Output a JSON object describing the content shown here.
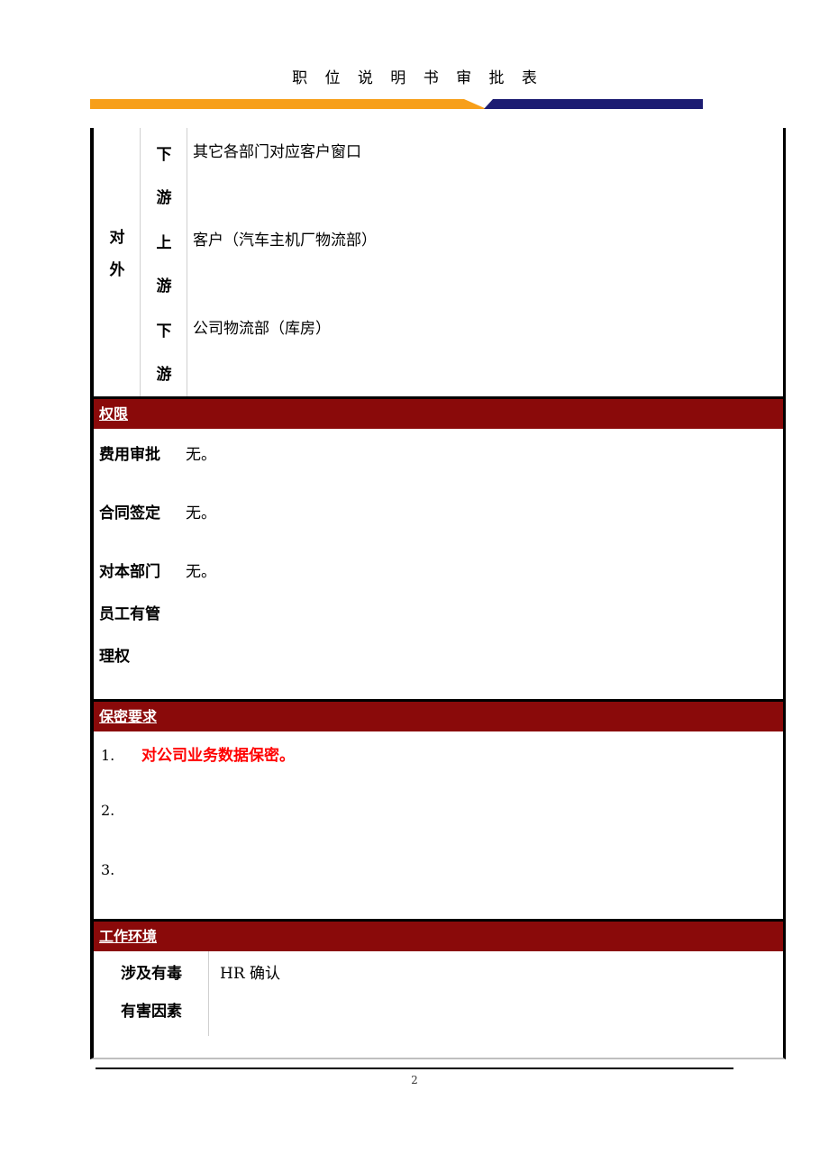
{
  "document": {
    "title": "职 位 说 明 书 审 批 表",
    "page_number": "2",
    "accent_orange": "#F79F1A",
    "accent_navy": "#1C1C72",
    "accent_red_band": "#8A0A0A",
    "highlight_text_color": "#FF0000"
  },
  "relations": {
    "category_label": "对外",
    "rows": [
      {
        "direction": "下游",
        "value": "其它各部门对应客户窗口"
      },
      {
        "direction": "上游",
        "value": "客户（汽车主机厂物流部）"
      },
      {
        "direction": "下游",
        "value": "公司物流部（库房）"
      }
    ]
  },
  "authority": {
    "section_title": "权限",
    "rows": [
      {
        "key": "费用审批",
        "value": "无。"
      },
      {
        "key": "合同签定",
        "value": "无。"
      },
      {
        "key": "对本部门",
        "value": "无。"
      }
    ],
    "key_continuation": [
      "员工有管",
      "理权"
    ]
  },
  "confidentiality": {
    "section_title": "保密要求",
    "items": [
      {
        "num": "1.",
        "text": "对公司业务数据保密。"
      },
      {
        "num": "2.",
        "text": ""
      },
      {
        "num": "3.",
        "text": ""
      }
    ]
  },
  "work_environment": {
    "section_title": "工作环境",
    "key_lines": [
      "涉及有毒",
      "有害因素"
    ],
    "value": "HR 确认"
  }
}
